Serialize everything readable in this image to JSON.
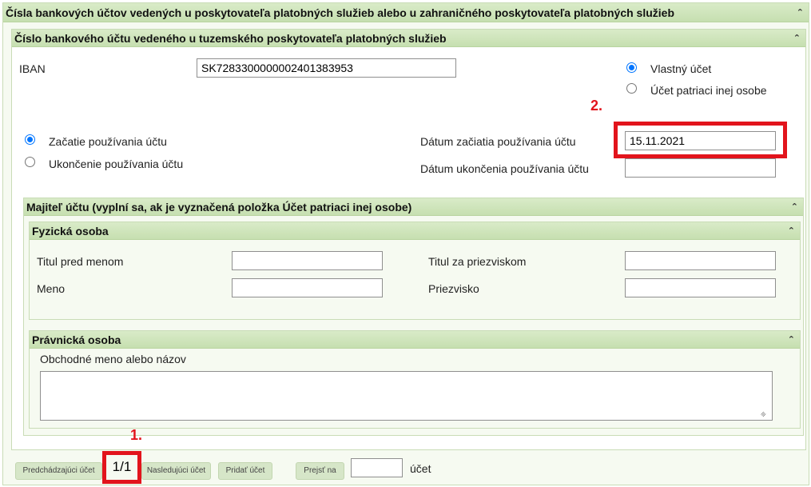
{
  "main_panel": {
    "title": "Čísla bankových účtov vedených u poskytovateľa platobných služieb alebo u zahraničného poskytovateľa platobných služieb"
  },
  "account_panel": {
    "title": "Číslo bankového účtu vedeného u tuzemského poskytovateľa platobných služieb",
    "iban_label": "IBAN",
    "iban_value": "SK7283300000002401383953",
    "own_account_label": "Vlastný účet",
    "other_account_label": "Účet patriaci inej osobe",
    "start_usage_label": "Začatie používania účtu",
    "end_usage_label": "Ukončenie používania účtu",
    "start_date_label": "Dátum začiatia používania účtu",
    "start_date_value": "15.11.2021",
    "end_date_label": "Dátum ukončenia používania účtu",
    "end_date_value": ""
  },
  "owner_panel": {
    "title": "Majiteľ účtu (vyplní sa, ak je vyznačená položka Účet patriaci inej osobe)",
    "natural_person": {
      "title": "Fyzická osoba",
      "title_before_label": "Titul pred menom",
      "title_after_label": "Titul za priezviskom",
      "first_name_label": "Meno",
      "last_name_label": "Priezvisko"
    },
    "legal_person": {
      "title": "Právnická osoba",
      "business_name_label": "Obchodné meno alebo názov"
    }
  },
  "annotations": {
    "step1": "1.",
    "step2": "2."
  },
  "navigation": {
    "prev_label": "Predchádzajúci účet",
    "counter": "1/1",
    "next_label": "Nasledujúci účet",
    "add_label": "Pridať účet",
    "goto_label": "Prejsť na",
    "goto_value": "",
    "account_suffix": "účet"
  },
  "colors": {
    "header_green": "#c6dfb0",
    "panel_bg": "#f6faf1",
    "highlight_red": "#e2141c",
    "radio_blue": "#0075ff"
  }
}
